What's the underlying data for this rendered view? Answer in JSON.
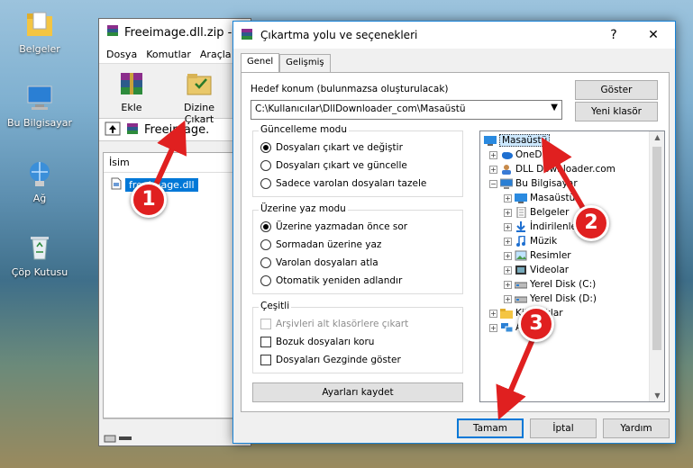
{
  "desktop": {
    "icons": [
      {
        "label": "Belgeler"
      },
      {
        "label": "Bu Bilgisayar"
      },
      {
        "label": "Ağ"
      },
      {
        "label": "Çöp Kutusu"
      }
    ]
  },
  "winrar": {
    "title": "Freeimage.dll.zip - W",
    "menu": [
      "Dosya",
      "Komutlar",
      "Araçla"
    ],
    "tools": [
      {
        "label": "Ekle"
      },
      {
        "label": "Dizine Çıkart"
      }
    ],
    "path": "Freeimage.",
    "list_header": "İsim",
    "file": "freeimage.dll"
  },
  "dialog": {
    "title": "Çıkartma yolu ve seçenekleri",
    "tabs": [
      "Genel",
      "Gelişmiş"
    ],
    "dest_label": "Hedef konum (bulunmazsa oluşturulacak)",
    "dest_value": "C:\\Kullanıcılar\\DllDownloader_com\\Masaüstü",
    "show_btn": "Göster",
    "new_folder_btn": "Yeni klasör",
    "update_group": {
      "caption": "Güncelleme modu",
      "options": [
        "Dosyaları çıkart ve değiştir",
        "Dosyaları çıkart ve güncelle",
        "Sadece varolan dosyaları tazele"
      ],
      "selected": 0
    },
    "overwrite_group": {
      "caption": "Üzerine yaz modu",
      "options": [
        "Üzerine yazmadan önce sor",
        "Sormadan üzerine yaz",
        "Varolan dosyaları atla",
        "Otomatik yeniden adlandır"
      ],
      "selected": 0
    },
    "misc_group": {
      "caption": "Çeşitli",
      "options": [
        "Arşivleri alt klasörlere çıkart",
        "Bozuk dosyaları koru",
        "Dosyaları Gezginde göster"
      ]
    },
    "save_settings_btn": "Ayarları kaydet",
    "tree": [
      {
        "label": "Masaüstü",
        "icon": "desktop-icon"
      },
      {
        "label": "OneDrive",
        "icon": "cloud-icon"
      },
      {
        "label": "DLL Downloader.com",
        "icon": "user-icon"
      },
      {
        "label": "Bu Bilgisayar",
        "icon": "computer-icon"
      },
      {
        "label": "Masaüstü",
        "icon": "desktop-icon"
      },
      {
        "label": "Belgeler",
        "icon": "document-icon"
      },
      {
        "label": "İndirilenler",
        "icon": "download-icon"
      },
      {
        "label": "Müzik",
        "icon": "music-icon"
      },
      {
        "label": "Resimler",
        "icon": "image-icon"
      },
      {
        "label": "Videolar",
        "icon": "video-icon"
      },
      {
        "label": "Yerel Disk (C:)",
        "icon": "disk-icon"
      },
      {
        "label": "Yerel Disk (D:)",
        "icon": "disk-icon"
      },
      {
        "label": "Kitaplıklar",
        "icon": "library-icon"
      },
      {
        "label": "Ağ",
        "icon": "network-icon"
      }
    ],
    "ok_btn": "Tamam",
    "cancel_btn": "İptal",
    "help_btn": "Yardım"
  },
  "markers": [
    "1",
    "2",
    "3"
  ],
  "colors": {
    "marker": "#e02020",
    "accent": "#0078d7"
  }
}
